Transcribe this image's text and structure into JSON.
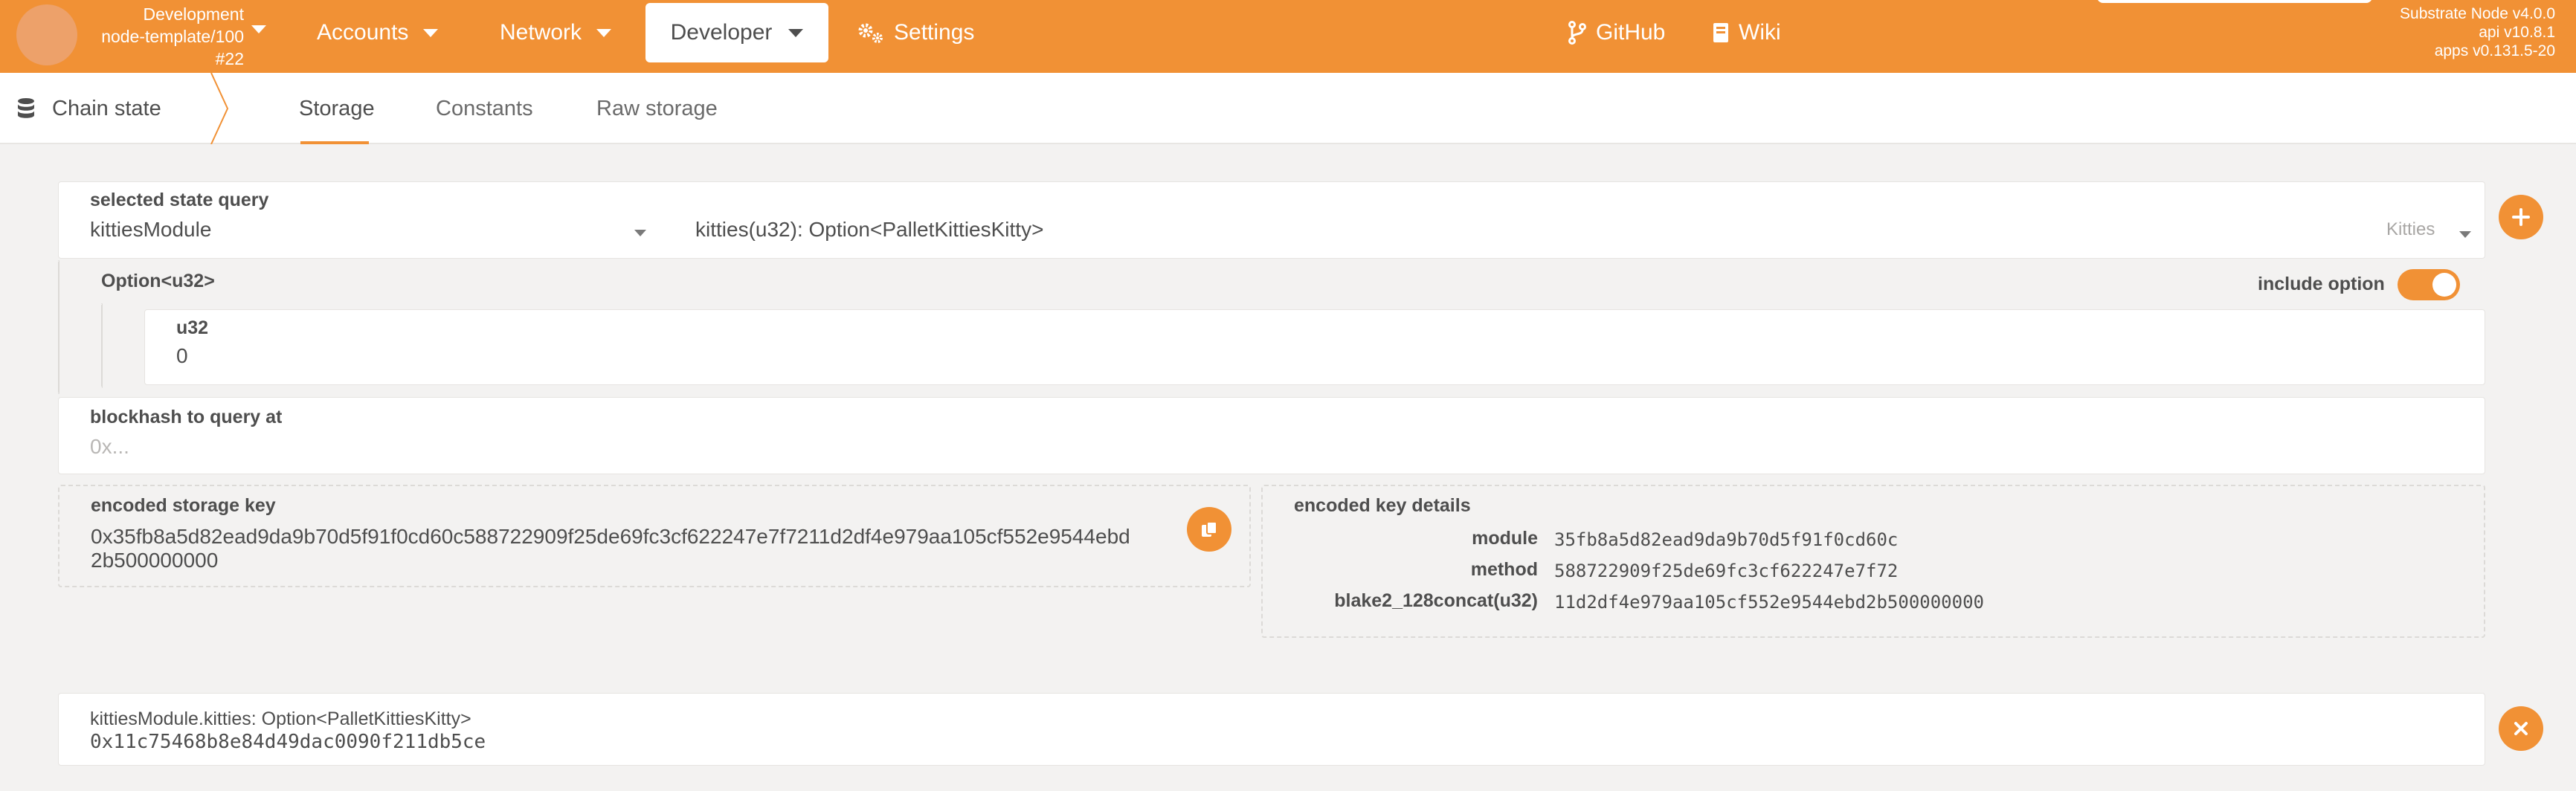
{
  "chain": {
    "name": "Development",
    "spec": "node-template/100",
    "block": "#22"
  },
  "nav": {
    "accounts": "Accounts",
    "network": "Network",
    "developer": "Developer",
    "settings": "Settings",
    "github": "GitHub",
    "wiki": "Wiki"
  },
  "node": {
    "name": "Substrate Node v4.0.0",
    "api": "api v10.8.1",
    "apps": "apps v0.131.5-20"
  },
  "subnav": {
    "title": "Chain state",
    "tabs": [
      "Storage",
      "Constants",
      "Raw storage"
    ]
  },
  "query": {
    "label": "selected state query",
    "module": "kittiesModule",
    "method": "kitties(u32): Option<PalletKittiesKitty>",
    "method_doc": "Kitties"
  },
  "option": {
    "label": "Option<u32>",
    "include_label": "include option",
    "include": true,
    "param_label": "u32",
    "param_value": "0"
  },
  "blockhash": {
    "label": "blockhash to query at",
    "placeholder": "0x..."
  },
  "encoded": {
    "label": "encoded storage key",
    "line1": "0x35fb8a5d82ead9da9b70d5f91f0cd60c588722909f25de69fc3cf622247e7f7211d2df4e979aa105cf552e9544ebd",
    "line2": "2b500000000"
  },
  "details": {
    "label": "encoded key details",
    "rows": [
      {
        "key": "module",
        "value": "35fb8a5d82ead9da9b70d5f91f0cd60c"
      },
      {
        "key": "method",
        "value": "588722909f25de69fc3cf622247e7f72"
      },
      {
        "key": "blake2_128concat(u32)",
        "value": "11d2df4e979aa105cf552e9544ebd2b500000000"
      }
    ]
  },
  "result": {
    "label": "kittiesModule.kitties: Option<PalletKittiesKitty>",
    "value": "0x11c75468b8e84d49dac0090f211db5ce"
  },
  "colors": {
    "accent": "#f19135"
  }
}
